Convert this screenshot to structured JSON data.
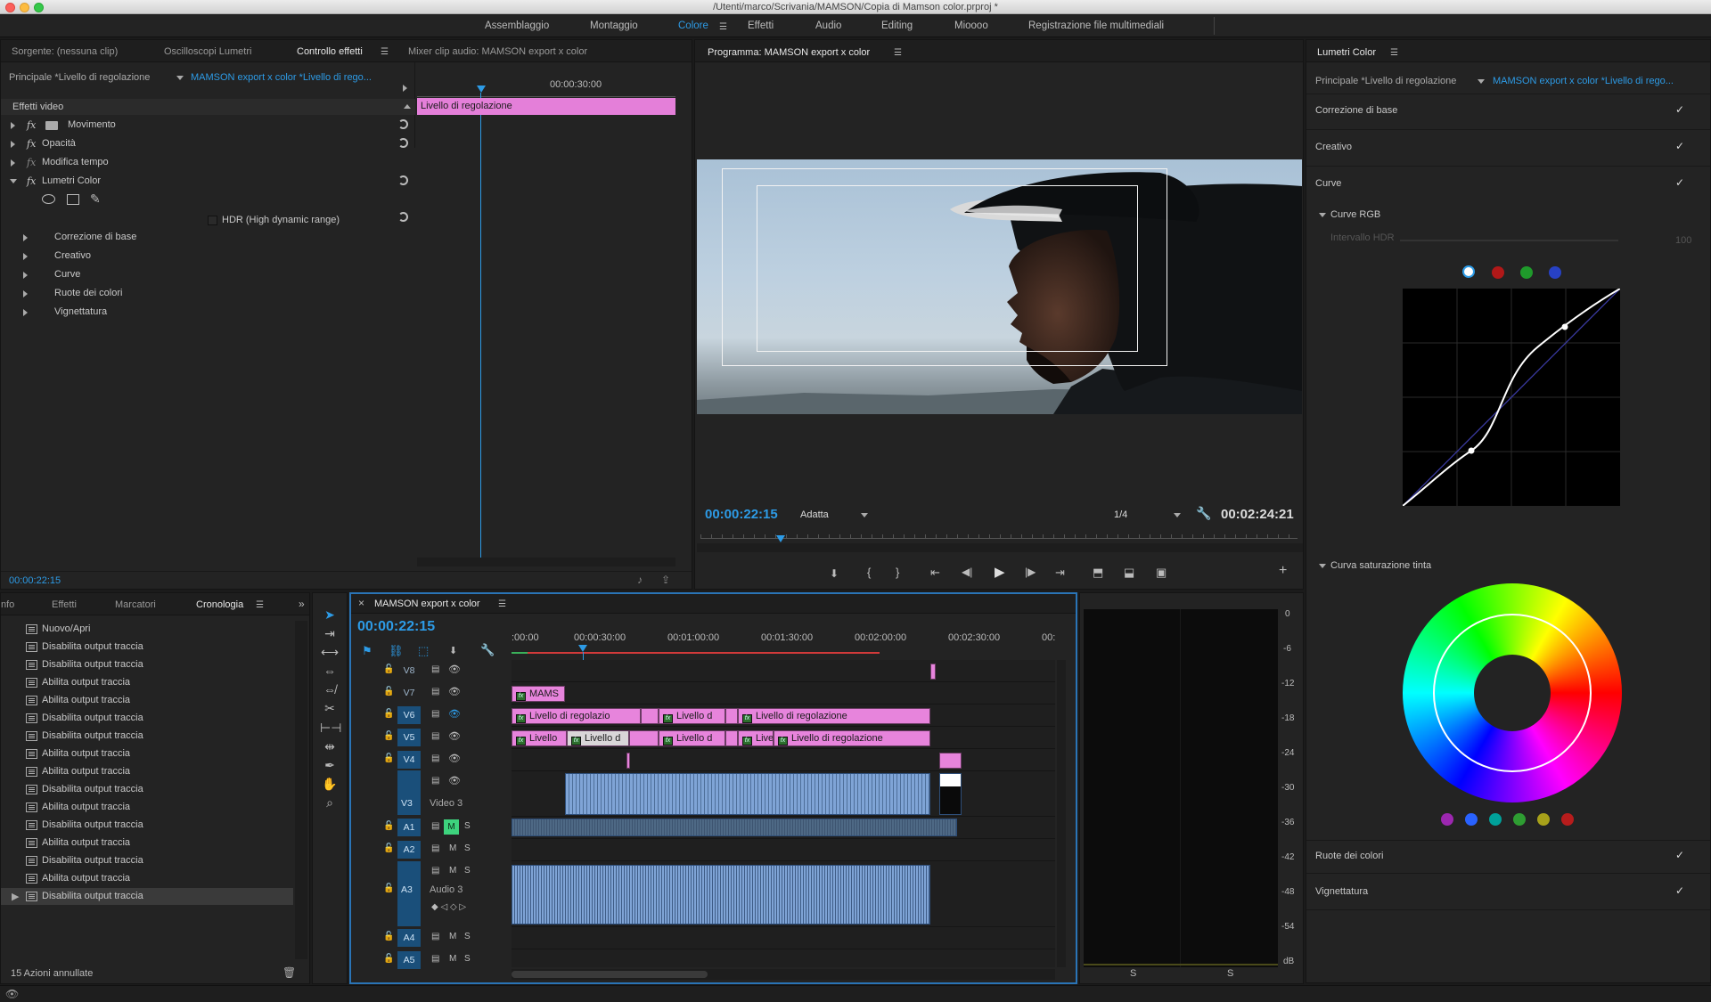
{
  "window": {
    "title": "/Utenti/marco/Scrivania/MAMSON/Copia di Mamson color.prproj *"
  },
  "workspaces": [
    {
      "label": "Assemblaggio",
      "active": false
    },
    {
      "label": "Montaggio",
      "active": false
    },
    {
      "label": "Colore",
      "active": true
    },
    {
      "label": "Effetti",
      "active": false
    },
    {
      "label": "Audio",
      "active": false
    },
    {
      "label": "Editing",
      "active": false
    },
    {
      "label": "Mioooo",
      "active": false
    },
    {
      "label": "Registrazione file multimediali",
      "active": false
    }
  ],
  "effect_controls": {
    "tabs": [
      "Sorgente: (nessuna clip)",
      "Oscilloscopi Lumetri",
      "Controllo effetti",
      "Mixer clip audio: MAMSON export x color"
    ],
    "active_tab": "Controllo effetti",
    "master_label": "Principale *Livello di regolazione",
    "sequence_label": "MAMSON export x color *Livello di rego...",
    "timecode_ruler": "00:00:30:00",
    "section_label": "Effetti video",
    "clip_label": "Livello di regolazione",
    "effects": [
      "Movimento",
      "Opacità",
      "Modifica tempo",
      "Lumetri Color"
    ],
    "hdr_label": "HDR (High dynamic range)",
    "sub_sections": [
      "Correzione di base",
      "Creativo",
      "Curve",
      "Ruote dei colori",
      "Vignettatura"
    ],
    "current_time": "00:00:22:15"
  },
  "program": {
    "title": "Programma: MAMSON export x color",
    "timecode": "00:00:22:15",
    "fit": "Adatta",
    "resolution": "1/4",
    "duration": "00:02:24:21",
    "playhead_fraction": 0.135
  },
  "lumetri": {
    "title": "Lumetri Color",
    "master_label": "Principale *Livello di regolazione",
    "sequence_label": "MAMSON export x color *Livello di rego...",
    "sections_top": [
      "Correzione di base",
      "Creativo",
      "Curve"
    ],
    "curve_rgb_label": "Curve RGB",
    "hdr_range_label": "Intervallo HDR",
    "hdr_range_value": "100",
    "curve_channels": [
      "#ffffff",
      "#b01818",
      "#1f9a2b",
      "#2741c4"
    ],
    "hue_sat_label": "Curva saturazione tinta",
    "hue_swatches": [
      "#9c27b0",
      "#2962ff",
      "#00a19a",
      "#2e9d32",
      "#a7a11a",
      "#b71c1c"
    ],
    "sections_bottom": [
      "Ruote dei colori",
      "Vignettatura"
    ]
  },
  "history": {
    "tabs": [
      "nfo",
      "Effetti",
      "Marcatori",
      "Cronologia"
    ],
    "active_tab": "Cronologia",
    "items": [
      "Nuovo/Apri",
      "Disabilita output traccia",
      "Disabilita output traccia",
      "Abilita output traccia",
      "Abilita output traccia",
      "Disabilita output traccia",
      "Disabilita output traccia",
      "Abilita output traccia",
      "Abilita output traccia",
      "Disabilita output traccia",
      "Abilita output traccia",
      "Disabilita output traccia",
      "Abilita output traccia",
      "Disabilita output traccia",
      "Abilita output traccia",
      "Disabilita output traccia"
    ],
    "footer": "15 Azioni annullate"
  },
  "timeline": {
    "title": "MAMSON export x color",
    "timecode": "00:00:22:15",
    "ruler": [
      ":00:00",
      "00:00:30:00",
      "00:01:00:00",
      "00:01:30:00",
      "00:02:00:00",
      "00:02:30:00",
      "00:"
    ],
    "tracks": [
      {
        "name": "V8",
        "sel": false
      },
      {
        "name": "V7",
        "sel": false
      },
      {
        "name": "V6",
        "sel": true
      },
      {
        "name": "V5",
        "sel": true
      },
      {
        "name": "V4",
        "sel": true
      }
    ],
    "v3_label": "Video 3",
    "v3_name": "V3",
    "audio": [
      {
        "name": "A1"
      },
      {
        "name": "A2"
      }
    ],
    "a3_name": "A3",
    "a3_label": "Audio 3",
    "audio_low": [
      {
        "name": "A4"
      },
      {
        "name": "A5"
      }
    ],
    "mute_label": "M",
    "solo_label": "S",
    "clips_v7": "MAMS",
    "clip_adj": "Livello di regolazione",
    "clip_adj_short1": "Livello di regolazio",
    "clip_adj_short2": "Livello d",
    "clip_adj_short3": "Livello",
    "clip_adj_short4": "Livello d",
    "clip_adj_short5": "Live"
  },
  "meter": {
    "scale": [
      "0",
      "-6",
      "-12",
      "-18",
      "-24",
      "-30",
      "-36",
      "-42",
      "-48",
      "-54",
      "dB"
    ],
    "bottom": [
      "S",
      "S"
    ]
  }
}
